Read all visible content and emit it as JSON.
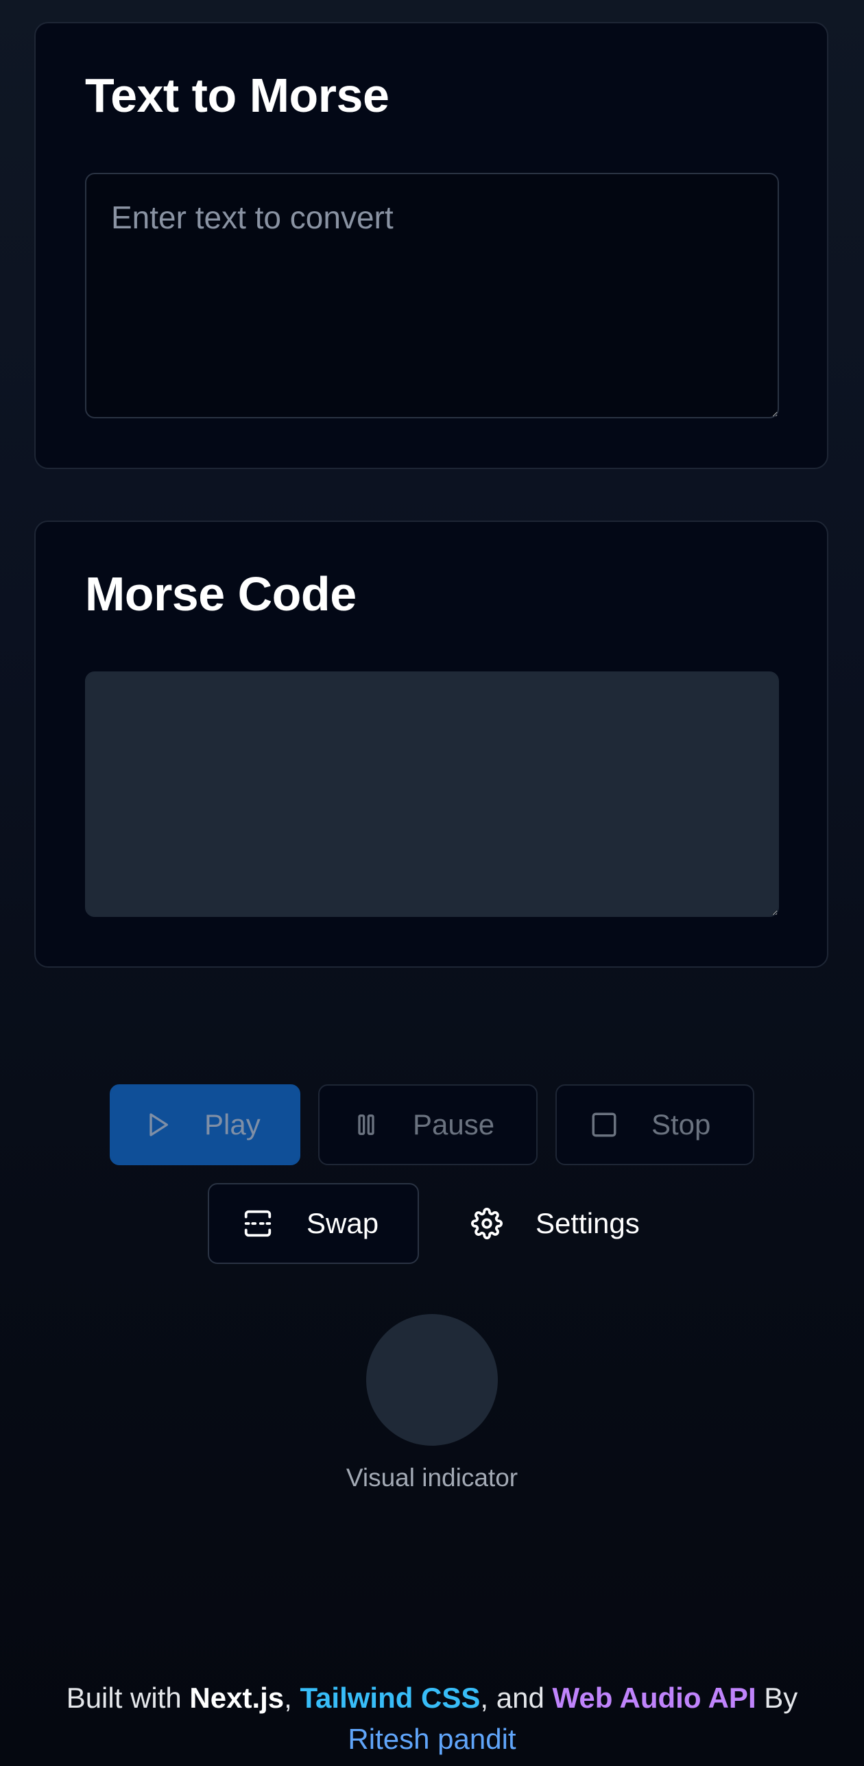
{
  "text_card": {
    "title": "Text to Morse",
    "input_placeholder": "Enter text to convert",
    "input_value": ""
  },
  "morse_card": {
    "title": "Morse Code",
    "output_value": ""
  },
  "controls": {
    "play_label": "Play",
    "pause_label": "Pause",
    "stop_label": "Stop",
    "swap_label": "Swap",
    "settings_label": "Settings",
    "icons": {
      "play": "play-icon",
      "pause": "pause-icon",
      "stop": "stop-icon",
      "swap": "swap-icon",
      "settings": "gear-icon"
    },
    "play_enabled": false,
    "pause_enabled": false,
    "stop_enabled": false
  },
  "indicator": {
    "label": "Visual indicator",
    "active": false
  },
  "footer": {
    "prefix": "Built with ",
    "nextjs": "Next.js",
    "sep1": ", ",
    "tailwind": "Tailwind CSS",
    "sep2": ", and ",
    "webaudio": "Web Audio API",
    "by": " By",
    "author": "Ritesh pandit"
  },
  "colors": {
    "primary_button": "#0f4f98",
    "tailwind_accent": "#38bdf8",
    "webaudio_accent": "#c084fc",
    "author_link": "#60a5fa",
    "indicator_idle": "#1f2937"
  }
}
